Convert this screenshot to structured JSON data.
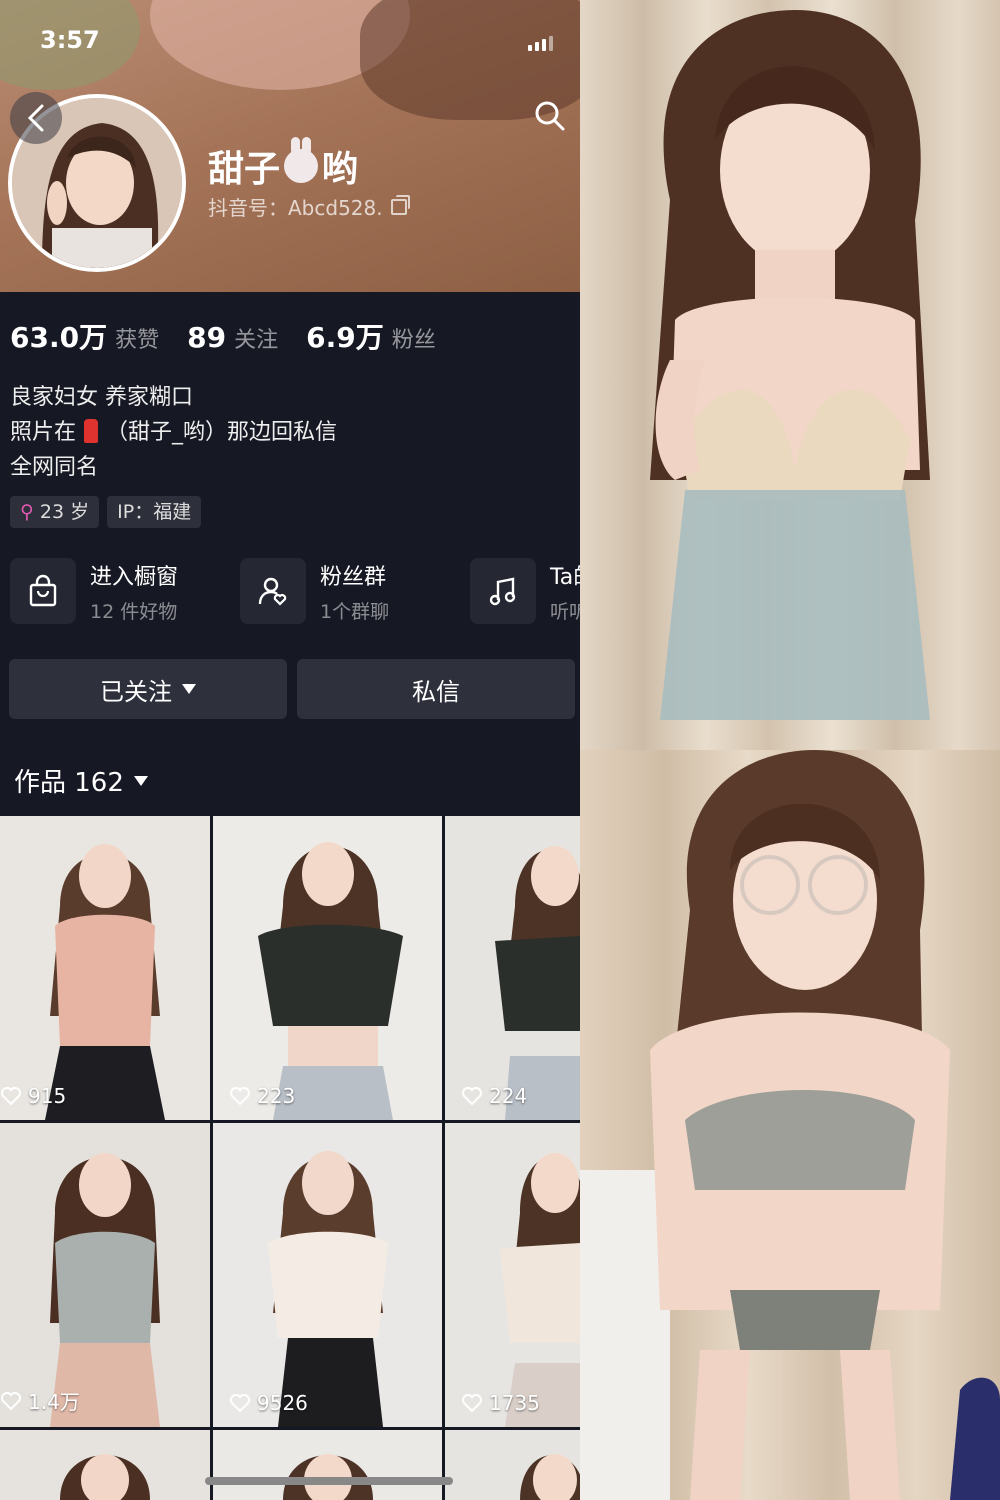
{
  "status_bar": {
    "time": "3:57"
  },
  "profile": {
    "name": "甜子",
    "name_suffix": "哟",
    "douyin_id": "抖音号：Abcd528."
  },
  "stats": [
    {
      "value": "63.0万",
      "label": "获赞"
    },
    {
      "value": "89",
      "label": "关注"
    },
    {
      "value": "6.9万",
      "label": "粉丝"
    }
  ],
  "bio": {
    "line1": "良家妇女 养家糊口",
    "line2_a": "照片在",
    "line2_b": "（甜子_哟）那边回私信",
    "line3": "全网同名"
  },
  "tags": {
    "age": "23 岁",
    "ip": "IP：福建"
  },
  "features": [
    {
      "title": "进入橱窗",
      "sub": "12 件好物",
      "icon": "shopping-bag-icon"
    },
    {
      "title": "粉丝群",
      "sub": "1个群聊",
      "icon": "fans-group-icon"
    },
    {
      "title": "Ta的",
      "sub": "听听t",
      "icon": "music-note-icon"
    }
  ],
  "actions": {
    "follow": "已关注",
    "message": "私信"
  },
  "works": {
    "label": "作品 162"
  },
  "grid": [
    {
      "likes": "915"
    },
    {
      "likes": "223"
    },
    {
      "likes": "224"
    },
    {
      "likes": "1.4万"
    },
    {
      "likes": "9526"
    },
    {
      "likes": "1735"
    }
  ],
  "colors": {
    "background": "#161823",
    "card": "#2e303b",
    "header_brown": "#a57458"
  }
}
